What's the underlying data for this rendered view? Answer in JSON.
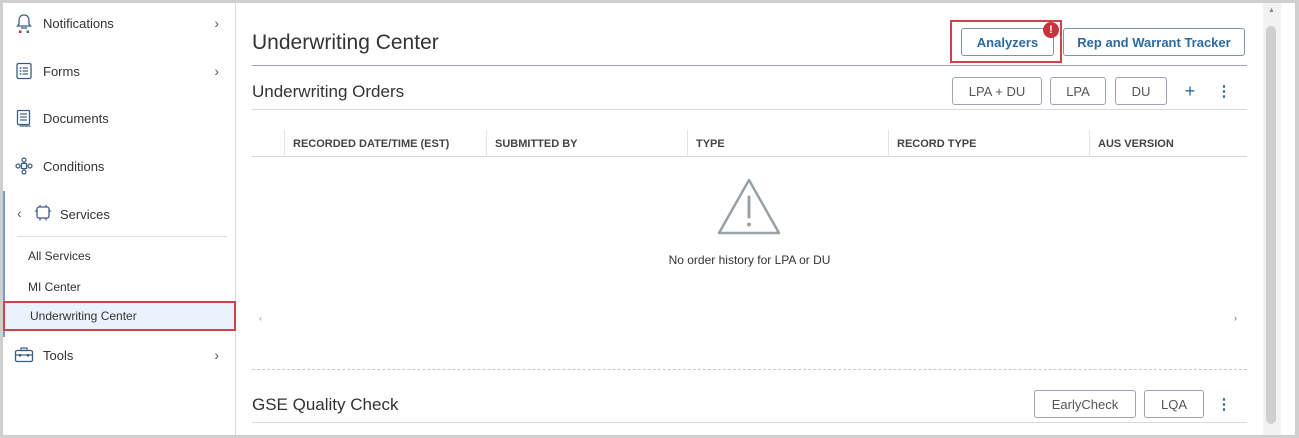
{
  "sidebar": {
    "items": [
      {
        "label": "Notifications",
        "icon": "bell-icon"
      },
      {
        "label": "Forms",
        "icon": "form-icon"
      },
      {
        "label": "Documents",
        "icon": "document-icon"
      },
      {
        "label": "Conditions",
        "icon": "conditions-icon"
      }
    ],
    "services": {
      "label": "Services",
      "icon": "services-icon",
      "sub_items": [
        "All Services",
        "MI Center",
        "Underwriting Center"
      ]
    },
    "tools": {
      "label": "Tools",
      "icon": "toolbox-icon"
    }
  },
  "header": {
    "title": "Underwriting Center",
    "analyzers_label": "Analyzers",
    "analyzers_badge": "!",
    "tracker_label": "Rep and Warrant Tracker"
  },
  "orders": {
    "title": "Underwriting Orders",
    "buttons": [
      "LPA + DU",
      "LPA",
      "DU"
    ],
    "columns": [
      "RECORDED DATE/TIME (EST)",
      "SUBMITTED BY",
      "TYPE",
      "RECORD TYPE",
      "AUS VERSION"
    ],
    "empty_message": "No order history for LPA or DU"
  },
  "quality": {
    "title": "GSE Quality Check",
    "buttons": [
      "EarlyCheck",
      "LQA"
    ]
  },
  "colors": {
    "accent": "#2c6aa0",
    "highlight_border": "#d0414b",
    "badge": "#c9313b",
    "icon": "#3b5e86"
  }
}
